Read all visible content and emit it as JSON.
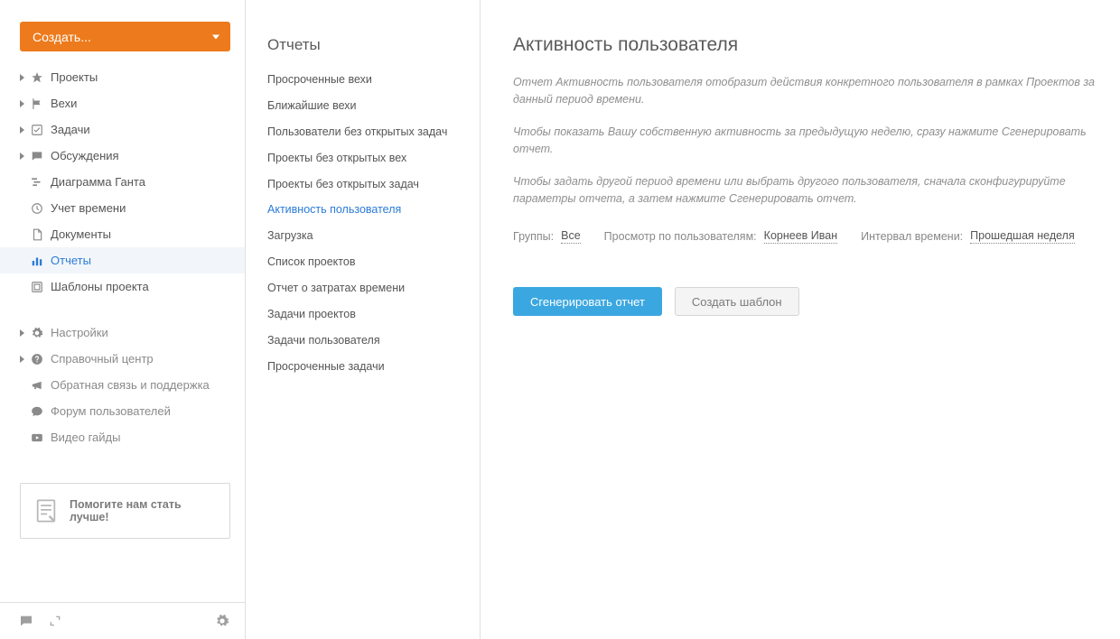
{
  "create_button": {
    "label": "Создать..."
  },
  "sidebar": {
    "items": [
      {
        "label": "Проекты",
        "icon": "compass-icon",
        "expandable": true
      },
      {
        "label": "Вехи",
        "icon": "flag-icon",
        "expandable": true
      },
      {
        "label": "Задачи",
        "icon": "checkbox-icon",
        "expandable": true
      },
      {
        "label": "Обсуждения",
        "icon": "speech-icon",
        "expandable": true
      },
      {
        "label": "Диаграмма Ганта",
        "icon": "gantt-icon",
        "expandable": false
      },
      {
        "label": "Учет времени",
        "icon": "clock-icon",
        "expandable": false
      },
      {
        "label": "Документы",
        "icon": "file-icon",
        "expandable": false
      },
      {
        "label": "Отчеты",
        "icon": "bars-icon",
        "expandable": false,
        "active": true
      },
      {
        "label": "Шаблоны проекта",
        "icon": "template-icon",
        "expandable": false
      }
    ],
    "settings_items": [
      {
        "label": "Настройки",
        "icon": "gear-icon",
        "expandable": true,
        "muted": true
      },
      {
        "label": "Справочный центр",
        "icon": "help-icon",
        "expandable": true,
        "muted": true
      },
      {
        "label": "Обратная связь и поддержка",
        "icon": "megaphone-icon",
        "expandable": false,
        "muted": true
      },
      {
        "label": "Форум пользователей",
        "icon": "bubble-icon",
        "expandable": false,
        "muted": true
      },
      {
        "label": "Видео гайды",
        "icon": "video-icon",
        "expandable": false,
        "muted": true
      }
    ],
    "help_box": {
      "text": "Помогите нам стать лучше!"
    }
  },
  "report_list": {
    "title": "Отчеты",
    "items": [
      "Просроченные вехи",
      "Ближайшие вехи",
      "Пользователи без открытых задач",
      "Проекты без открытых вех",
      "Проекты без открытых задач",
      "Активность пользователя",
      "Загрузка",
      "Список проектов",
      "Отчет о затратах времени",
      "Задачи проектов",
      "Задачи пользователя",
      "Просроченные задачи"
    ],
    "active_index": 5
  },
  "main": {
    "title": "Активность пользователя",
    "paragraphs": [
      "Отчет Активность пользователя отобразит действия конкретного пользователя в рамках Проектов за данный период времени.",
      "Чтобы показать Вашу собственную активность за предыдущую неделю, сразу нажмите Сгенерировать отчет.",
      "Чтобы задать другой период времени или выбрать другого пользователя, сначала сконфигурируйте параметры отчета, а затем нажмите Сгенерировать отчет."
    ],
    "filters": {
      "groups_label": "Группы:",
      "groups_value": "Все",
      "user_label": "Просмотр по пользователям:",
      "user_value": "Корнеев Иван",
      "period_label": "Интервал времени:",
      "period_value": "Прошедшая неделя"
    },
    "buttons": {
      "generate": "Сгенерировать отчет",
      "template": "Создать шаблон"
    }
  }
}
